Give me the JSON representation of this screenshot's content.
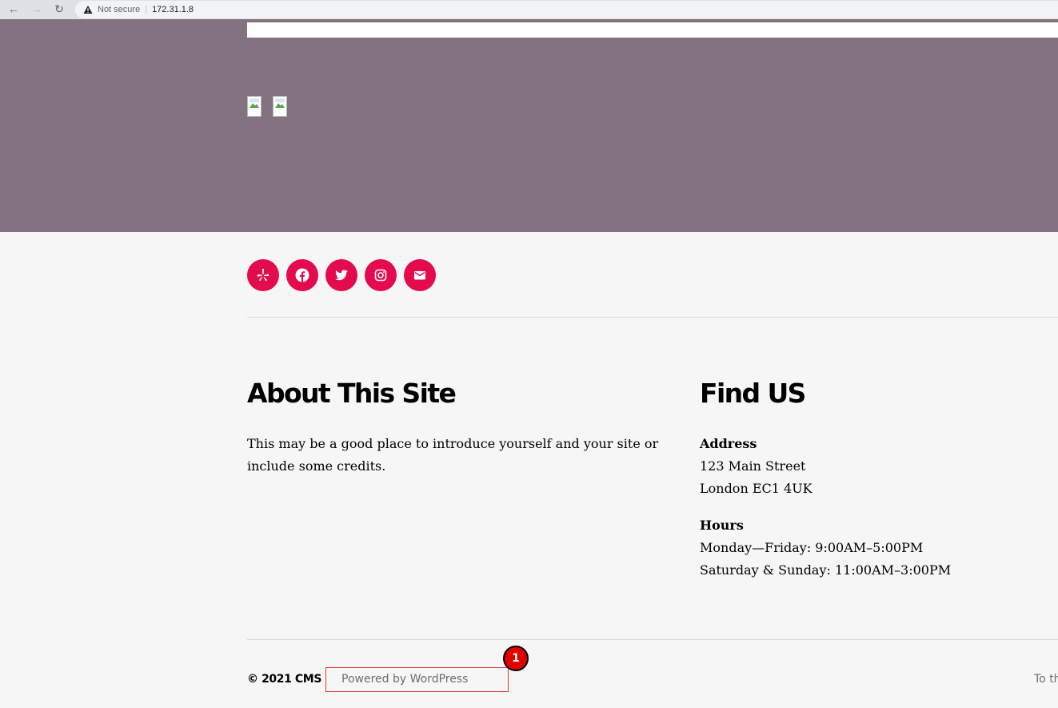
{
  "browser": {
    "security_label": "Not secure",
    "url": "172.31.1.8"
  },
  "social": {
    "icons": [
      "yelp-icon",
      "facebook-icon",
      "twitter-icon",
      "instagram-icon",
      "mail-icon"
    ],
    "color": "#e30a4d"
  },
  "hero": {
    "background": "#83727f"
  },
  "about": {
    "title": "About This Site",
    "text_line1": "This may be a good place to introduce yourself and your site or",
    "text_line2": "include some credits."
  },
  "find_us": {
    "title": "Find US",
    "address_heading": "Address",
    "address_line1": "123 Main Street",
    "address_line2": "London EC1 4UK",
    "hours_heading": "Hours",
    "hours_line1": "Monday—Friday: 9:00AM–5:00PM",
    "hours_line2": "Saturday & Sunday: 11:00AM–3:00PM"
  },
  "footer": {
    "copyright": "© 2021 CMS",
    "powered_by": "Powered by WordPress",
    "to_top": "To the top ↑"
  },
  "annotation": {
    "marker_label": "1"
  }
}
